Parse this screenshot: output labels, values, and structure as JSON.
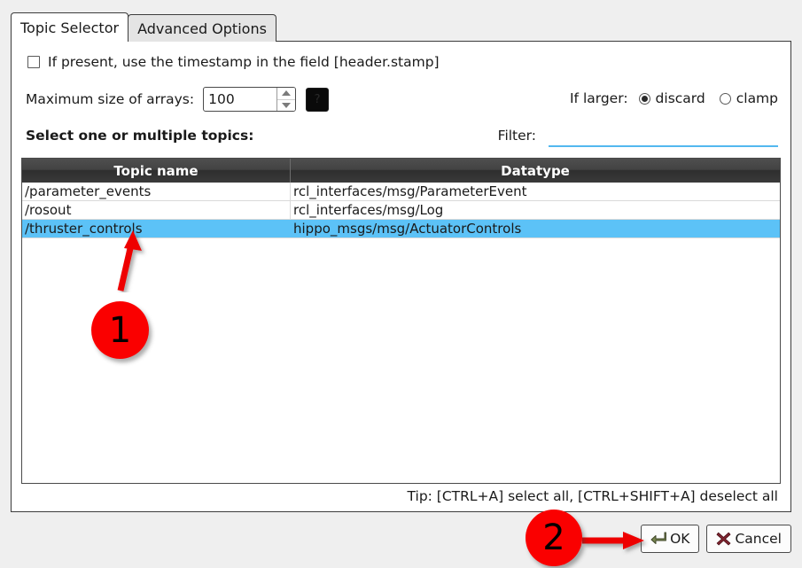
{
  "tabs": [
    {
      "label": "Topic Selector",
      "active": true
    },
    {
      "label": "Advanced Options",
      "active": false
    }
  ],
  "timestamp_option": {
    "label": "If present, use the timestamp in the field [header.stamp]",
    "checked": false,
    "checkbox_icon": "checkbox-unchecked-icon"
  },
  "max_size": {
    "label": "Maximum size of arrays:",
    "value": "100",
    "placeholder": "",
    "spinner_up_icon": "chevron-up-icon",
    "spinner_down_icon": "chevron-down-icon",
    "color_button_label": "?",
    "color_button_color": "#0a0a0a"
  },
  "if_larger": {
    "label": "If larger:",
    "options": [
      {
        "label": "discard",
        "selected": true
      },
      {
        "label": "clamp",
        "selected": false
      }
    ]
  },
  "select_label": "Select one or multiple topics:",
  "filter": {
    "label": "Filter:",
    "value": "",
    "placeholder": "",
    "underline_color": "#53b8ef"
  },
  "table": {
    "columns": [
      "Topic name",
      "Datatype"
    ],
    "rows": [
      {
        "topic": "/parameter_events",
        "datatype": "rcl_interfaces/msg/ParameterEvent",
        "selected": false
      },
      {
        "topic": "/rosout",
        "datatype": "rcl_interfaces/msg/Log",
        "selected": false
      },
      {
        "topic": "/thruster_controls",
        "datatype": "hippo_msgs/msg/ActuatorControls",
        "selected": true
      }
    ],
    "selection_color": "#5cc2f7",
    "header_color": "#3a3a3a"
  },
  "tip_text": "Tip: [CTRL+A] select all, [CTRL+SHIFT+A] deselect all",
  "buttons": [
    {
      "label": "OK",
      "icon": "enter-arrow-icon",
      "icon_color": "#6b7a4a"
    },
    {
      "label": "Cancel",
      "icon": "x-mark-icon",
      "icon_color": "#7a1f27"
    }
  ],
  "annotations": {
    "markers": [
      {
        "number": "1",
        "color": "#fa0000"
      },
      {
        "number": "2",
        "color": "#fa0000"
      }
    ],
    "arrow_color": "#ee0000"
  }
}
